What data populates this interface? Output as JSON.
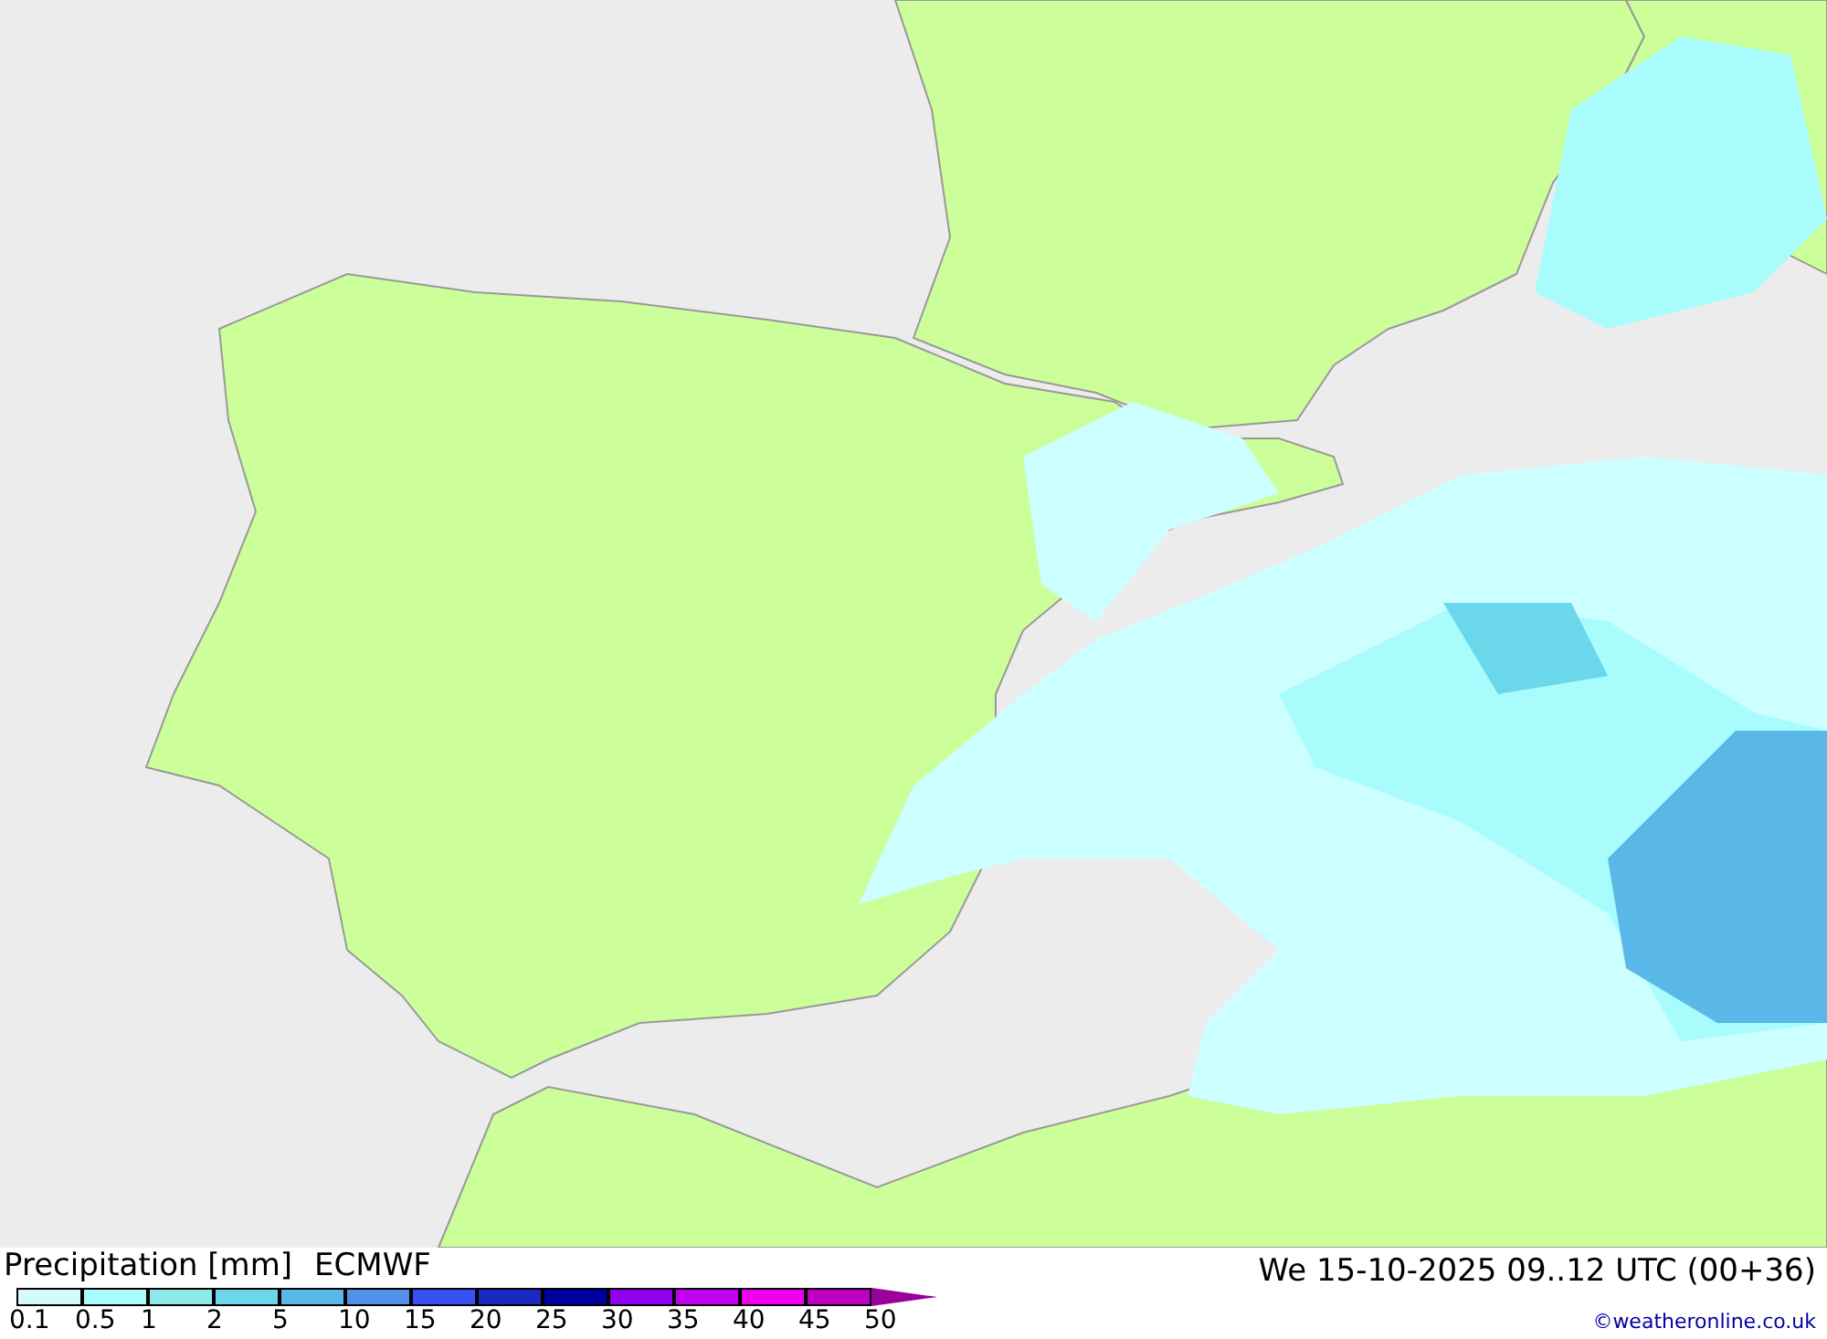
{
  "title": "Precipitation [mm]",
  "model": "ECMWF",
  "valid_time": "We 15-10-2025 09..12 UTC (00+36)",
  "legend": {
    "scale": [
      {
        "color": "#d4fafa"
      },
      {
        "color": "#a8fcfc"
      },
      {
        "color": "#8eeaea"
      },
      {
        "color": "#6ad8ea"
      },
      {
        "color": "#5ab8e8"
      },
      {
        "color": "#5090e8"
      },
      {
        "color": "#3850f0"
      },
      {
        "color": "#1a2ac0"
      },
      {
        "color": "#0000a0"
      },
      {
        "color": "#9000f0"
      },
      {
        "color": "#c000f0"
      },
      {
        "color": "#f000f0"
      },
      {
        "color": "#c000c0"
      }
    ],
    "ticks": [
      "0.1",
      "0.5",
      "1",
      "2",
      "5",
      "10",
      "15",
      "20",
      "25",
      "30",
      "35",
      "40",
      "45",
      "50"
    ]
  },
  "credit": "©weatheronline.co.uk"
}
